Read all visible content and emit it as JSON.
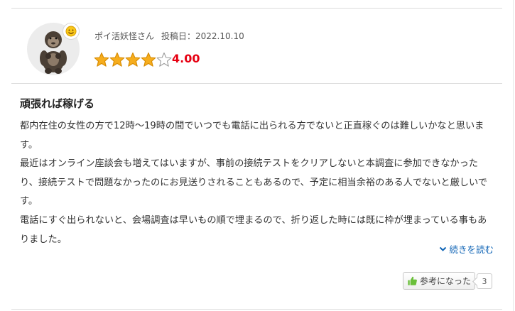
{
  "review": {
    "reviewer": "ポイ活妖怪さん",
    "post_date": "投稿日：2022.10.10",
    "rating": 4.0,
    "rating_text": "4.00",
    "rating_max": 5,
    "title": "頑張れば稼げる",
    "body": [
      "都内在住の女性の方で12時～19時の間でいつでも電話に出られる方でないと正直稼ぐのは難しいかなと思います。",
      "最近はオンライン座談会も増えてはいますが、事前の接続テストをクリアしないと本調査に参加できなかったり、接続テストで問題なかったのにお見送りされることもあるので、予定に相当余裕のある人でないと厳しいです。",
      "電話にすぐ出られないと、会場調査は早いもの順で埋まるので、折り返した時には既に枠が埋まっている事もありました。"
    ],
    "read_more": "続きを読む",
    "helpful_label": "参考になった",
    "helpful_count": "3"
  },
  "icons": {
    "avatar": "gorilla-avatar",
    "badge": "smiley-icon",
    "star": "star-icon",
    "chevron": "chevron-down-icon",
    "thumb": "thumbs-up-icon"
  },
  "colors": {
    "star_fill": "#f6ad1d",
    "score": "#e60012",
    "link": "#0e63b5",
    "thumb": "#6abf3a"
  }
}
